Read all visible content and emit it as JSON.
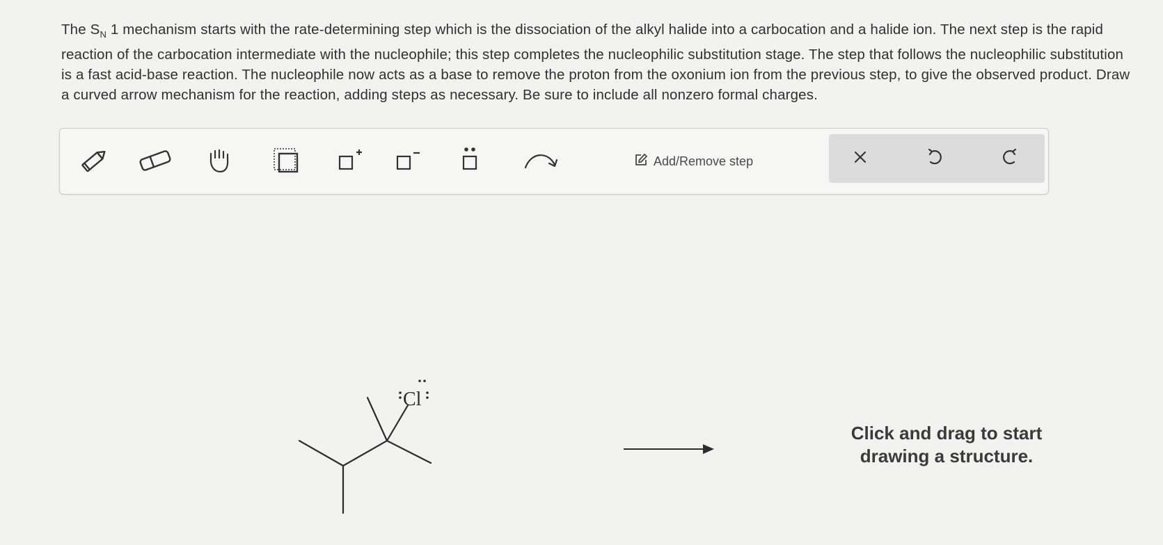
{
  "question": {
    "p1": "The S",
    "sub": "N",
    "p2": " 1 mechanism starts with the rate-determining step which is the dissociation of the alkyl halide into a carbocation and a halide ion. The next step is the rapid reaction of the carbocation intermediate with the nucleophile; this step completes the nucleophilic substitution stage. The step that follows the nucleophilic substitution is a fast acid-base reaction. The nucleophile now acts as a base to remove the proton from the oxonium ion from the previous step, to give the observed product. Draw a curved arrow mechanism for the reaction, adding steps as necessary. Be sure to include all nonzero formal charges."
  },
  "toolbar": {
    "tools": [
      {
        "icon": "pencil-icon"
      },
      {
        "icon": "eraser-icon"
      },
      {
        "icon": "hand-icon"
      },
      {
        "icon": "selection-icon"
      },
      {
        "icon": "positive-charge-icon",
        "label": "+"
      },
      {
        "icon": "negative-charge-icon",
        "label": "−"
      },
      {
        "icon": "lone-pair-icon"
      },
      {
        "icon": "curved-arrow-icon"
      }
    ],
    "add_remove_step": "Add/Remove step",
    "actions": [
      {
        "icon": "close-icon"
      },
      {
        "icon": "undo-icon"
      },
      {
        "icon": "redo-icon"
      }
    ]
  },
  "molecule": {
    "atom_label": "Cl",
    "lone_pairs": 3,
    "name_hidden": "tert-alkyl chloride skeleton"
  },
  "canvas": {
    "hint": "Click and drag to start drawing a structure."
  },
  "colors": {
    "background": "#f2f2f0",
    "toolbar_right_bg": "#dcdcdc",
    "ink": "#2b2b2b"
  }
}
